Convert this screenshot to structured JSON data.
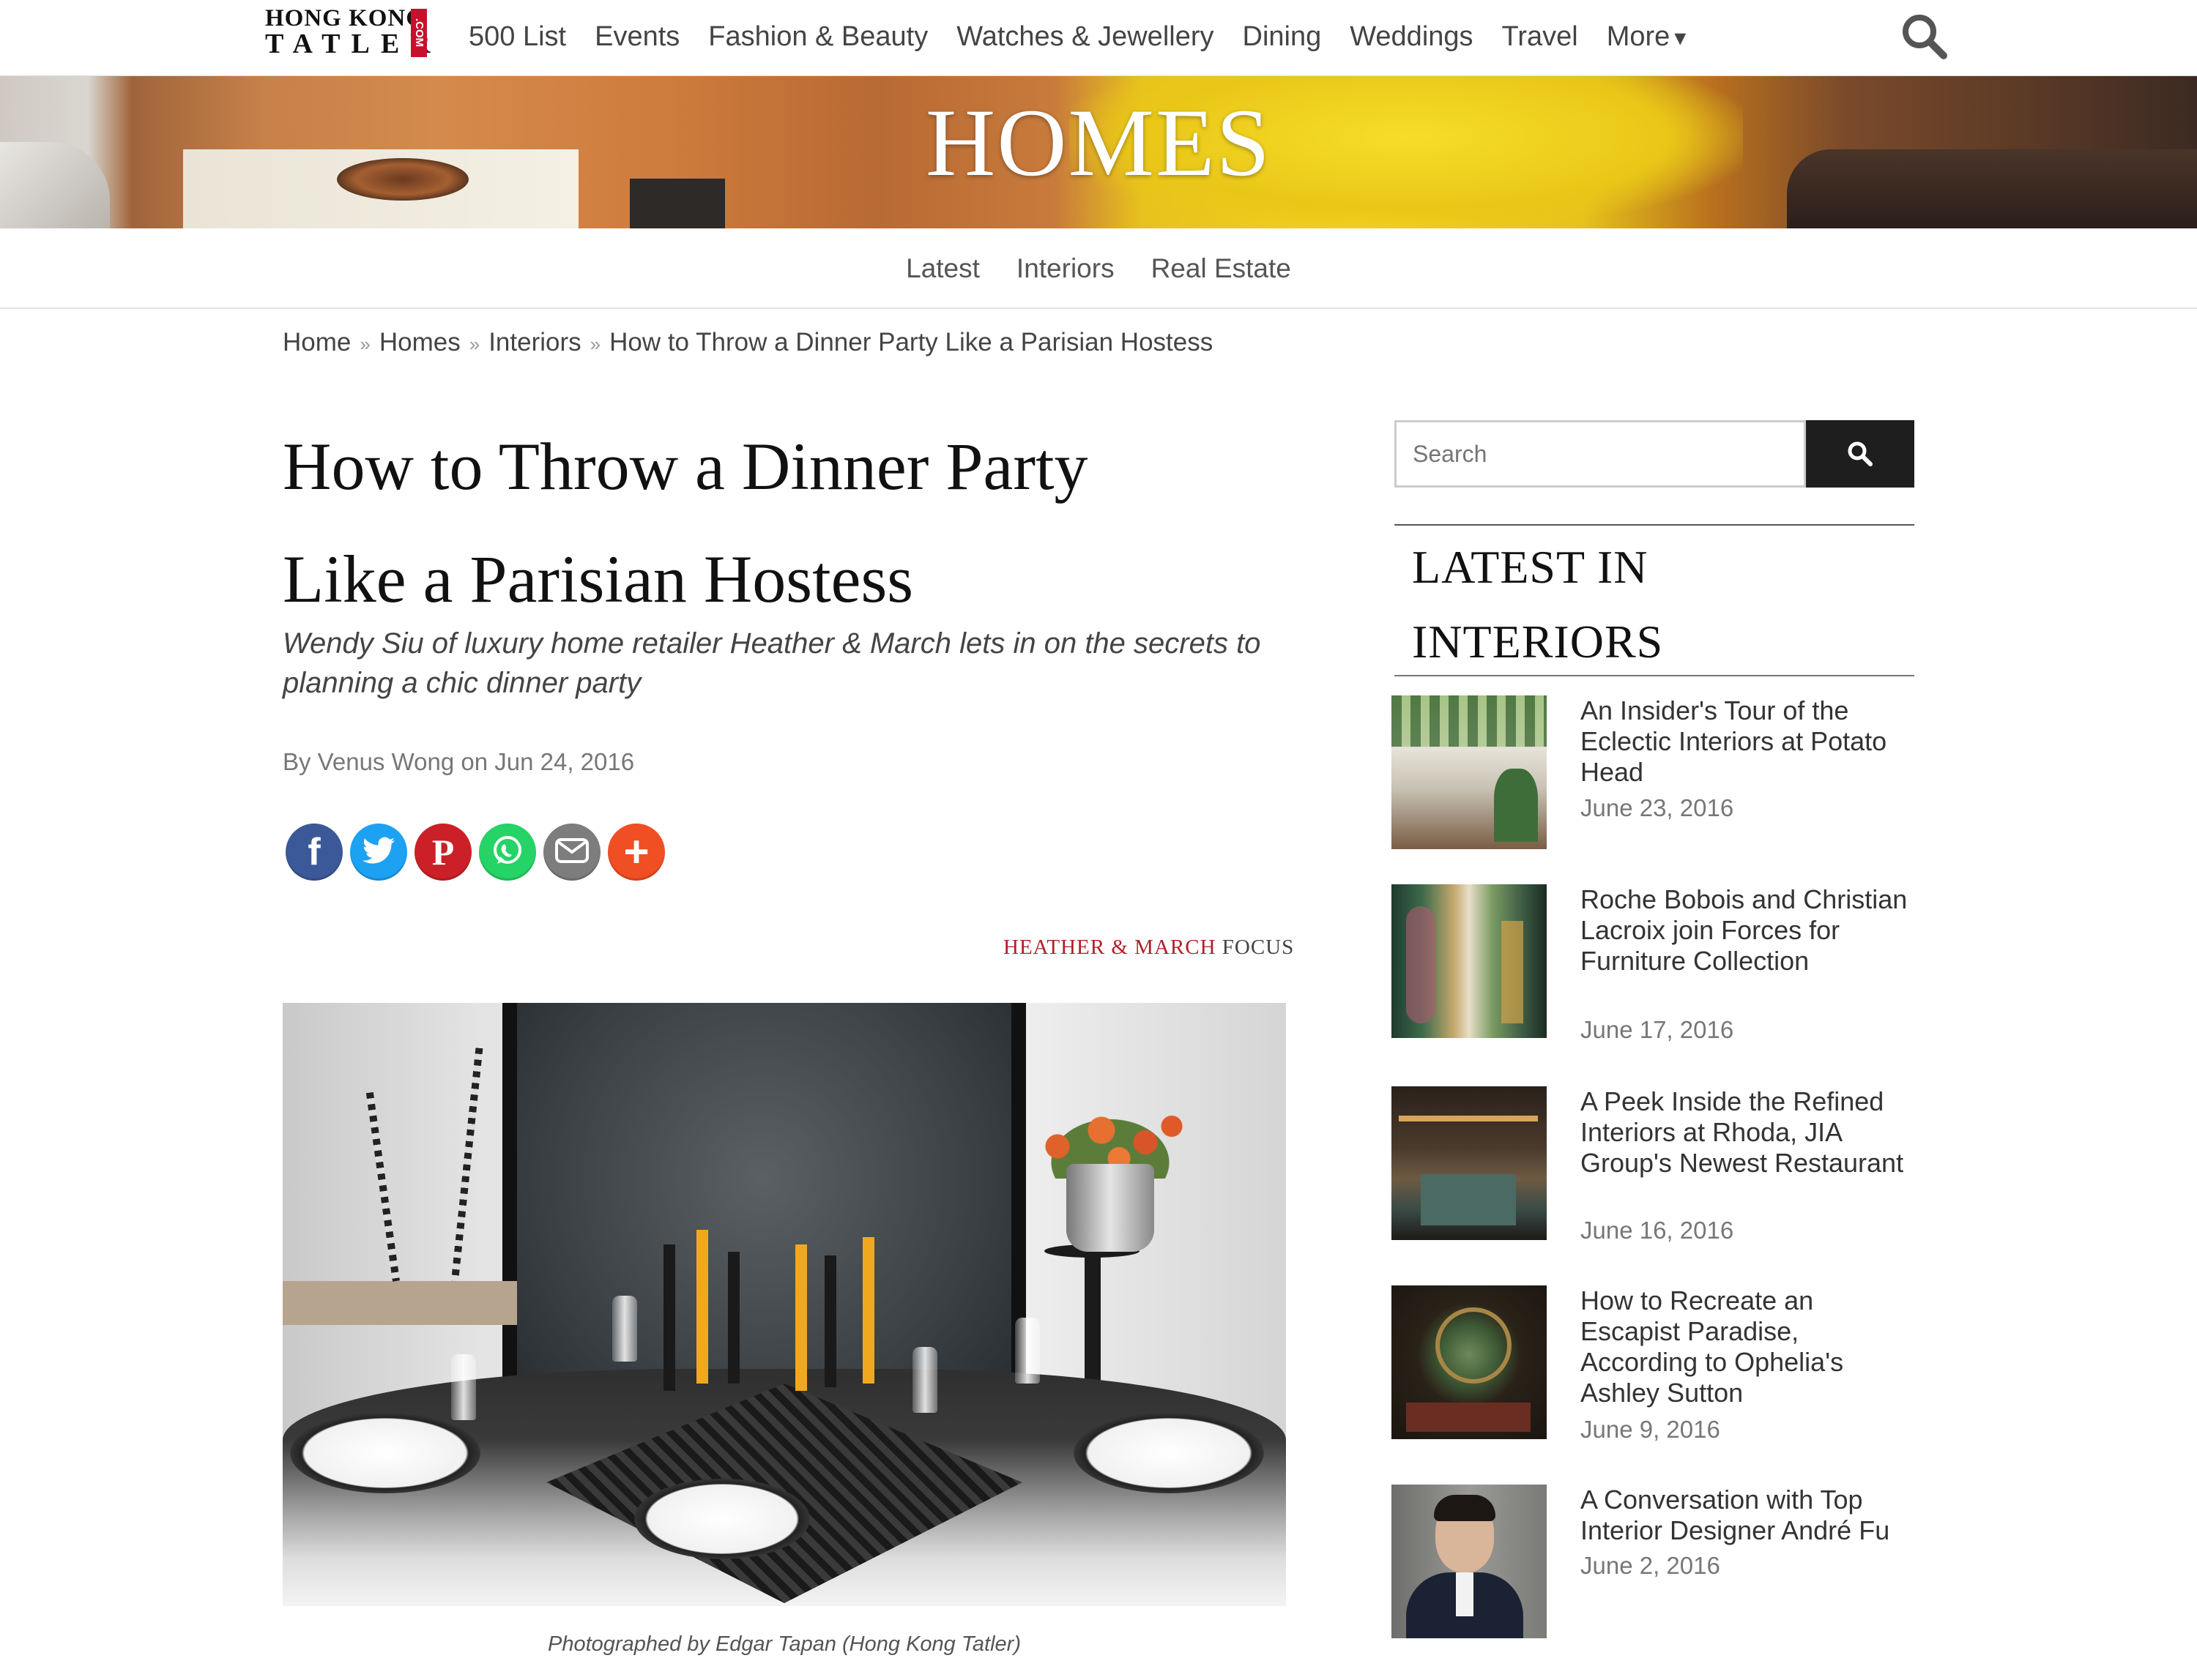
{
  "nav": {
    "logo_line1": "HONG KONG",
    "logo_line2": "TATLER",
    "logo_suffix": ".COM",
    "items": [
      "500 List",
      "Events",
      "Fashion & Beauty",
      "Watches & Jewellery",
      "Dining",
      "Weddings",
      "Travel",
      "More"
    ],
    "search_icon": "search-icon"
  },
  "banner": {
    "title": "HOMES"
  },
  "subnav": {
    "items": [
      "Latest",
      "Interiors",
      "Real Estate"
    ]
  },
  "breadcrumb": [
    "Home",
    "Homes",
    "Interiors",
    "How to Throw a Dinner Party Like a Parisian Hostess"
  ],
  "breadcrumb_sep": "»",
  "article": {
    "title_line1": "How to Throw a Dinner Party",
    "title_line2": "Like a Parisian Hostess",
    "dek": "Wendy Siu of luxury home retailer Heather & March lets in on the secrets to planning a chic dinner party",
    "byline": "By Venus Wong on Jun 24, 2016",
    "focus_brand": "HEATHER & MARCH",
    "focus_word": "FOCUS",
    "caption": "Photographed by Edgar Tapan (Hong Kong Tatler)"
  },
  "social": [
    {
      "name": "facebook",
      "icon": "facebook-icon",
      "color": "#3b5998",
      "glyph": "f"
    },
    {
      "name": "twitter",
      "icon": "twitter-icon",
      "color": "#1da1f2",
      "glyph": "t"
    },
    {
      "name": "pinterest",
      "icon": "pinterest-icon",
      "color": "#cb2027",
      "glyph": "P"
    },
    {
      "name": "whatsapp",
      "icon": "whatsapp-icon",
      "color": "#25d366",
      "glyph": "w"
    },
    {
      "name": "email",
      "icon": "mail-icon",
      "color": "#7d7d7d",
      "glyph": "✉"
    },
    {
      "name": "more",
      "icon": "plus-icon",
      "color": "#f04e23",
      "glyph": "+"
    }
  ],
  "sidebar": {
    "search_placeholder": "Search",
    "heading": "LATEST IN INTERIORS",
    "items": [
      {
        "title": "An Insider's Tour of the Eclectic Interiors at Potato Head",
        "date": "June 23, 2016"
      },
      {
        "title": "Roche Bobois and Christian Lacroix join Forces for Furniture Collection",
        "date": "June 17, 2016"
      },
      {
        "title": "A Peek Inside the Refined Interiors at Rhoda, JIA Group's Newest Restaurant",
        "date": "June 16, 2016"
      },
      {
        "title": "How to Recreate an Escapist Paradise, According to Ophelia's Ashley Sutton",
        "date": "June 9, 2016"
      },
      {
        "title": "A Conversation with Top Interior Designer André Fu",
        "date": "June 2, 2016"
      }
    ]
  },
  "colors": {
    "accent": "#b0202a",
    "search_button": "#1e1e1e"
  }
}
